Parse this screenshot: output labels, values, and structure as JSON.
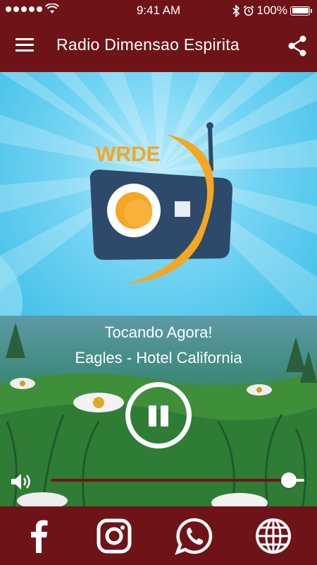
{
  "status_bar": {
    "time": "9:41 AM",
    "battery": "100%",
    "icons": [
      "signal-dots-icon",
      "wifi-icon",
      "bluetooth-icon",
      "alarm-icon",
      "battery-icon"
    ]
  },
  "app_bar": {
    "title": "Radio Dimensao Espirita",
    "menu_icon": "hamburger-menu-icon",
    "share_icon": "share-icon"
  },
  "logo": {
    "text": "WRDE"
  },
  "player": {
    "now_playing_label": "Tocando Agora!",
    "track": "Eagles - Hotel California",
    "state": "playing",
    "control_icon": "pause-icon",
    "volume_level": 0.94
  },
  "social_links": [
    {
      "name": "facebook",
      "icon": "facebook-icon"
    },
    {
      "name": "instagram",
      "icon": "instagram-icon"
    },
    {
      "name": "whatsapp",
      "icon": "whatsapp-icon"
    },
    {
      "name": "website",
      "icon": "globe-icon"
    }
  ],
  "colors": {
    "primary": "#6e1418",
    "sky": "#3ebfe8",
    "logo_orange": "#f5a623",
    "logo_navy": "#2e4a6b"
  }
}
